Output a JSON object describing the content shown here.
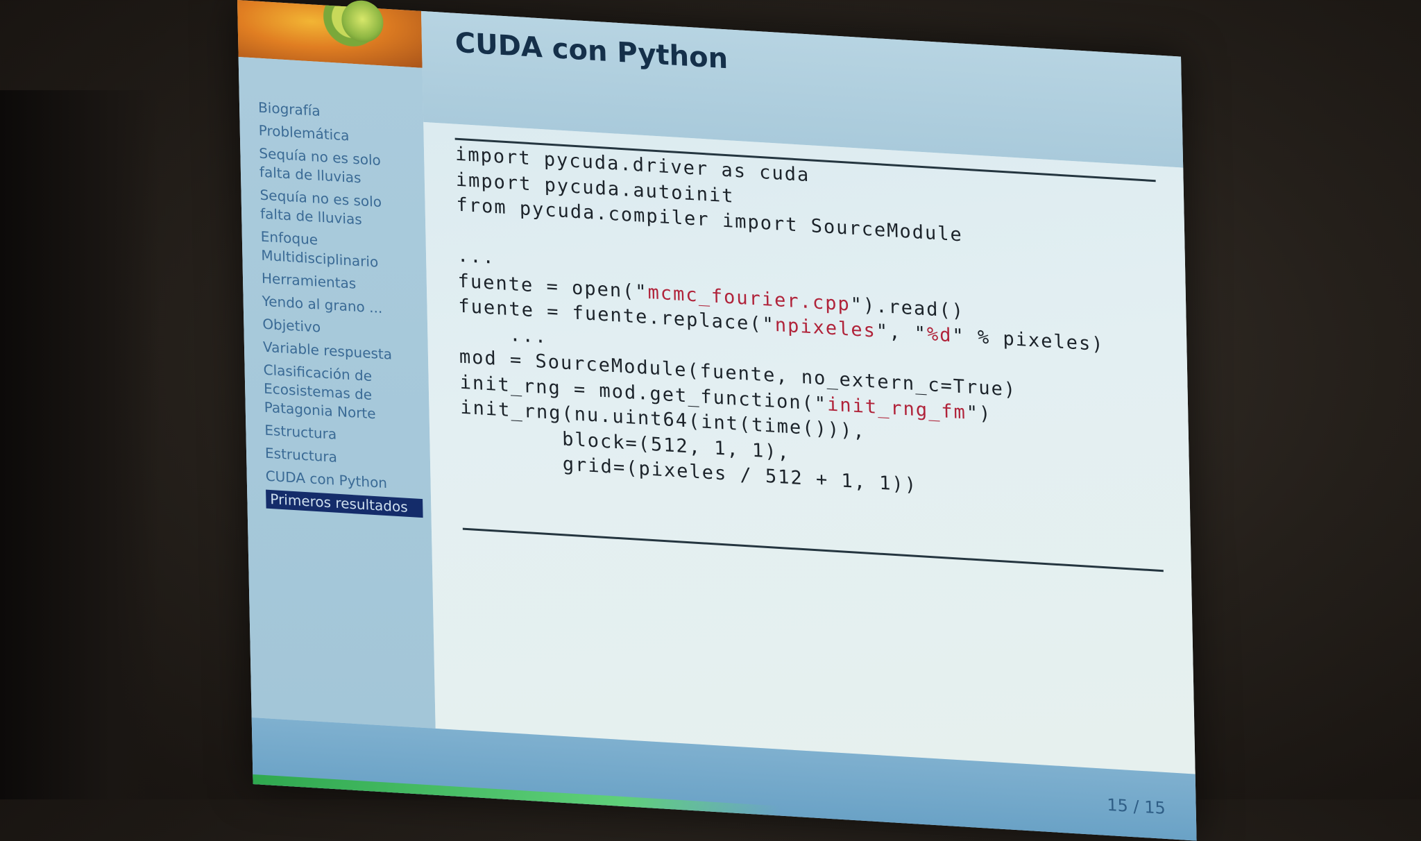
{
  "slide": {
    "title": "CUDA con Python",
    "page_number": "15 / 15"
  },
  "sidebar": {
    "items": [
      {
        "label": "Biografía"
      },
      {
        "label": "Problemática"
      },
      {
        "label": "Sequía no es solo falta de lluvias"
      },
      {
        "label": "Sequía no es solo falta de lluvias"
      },
      {
        "label": "Enfoque Multidisciplinario"
      },
      {
        "label": "Herramientas"
      },
      {
        "label": "Yendo al grano ..."
      },
      {
        "label": "Objetivo"
      },
      {
        "label": "Variable respuesta"
      },
      {
        "label": "Clasificación de Ecosistemas de Patagonia Norte"
      },
      {
        "label": "Estructura"
      },
      {
        "label": "Estructura"
      },
      {
        "label": "CUDA con Python"
      },
      {
        "label": "Primeros resultados"
      }
    ],
    "active_index": 13
  },
  "code": {
    "lines": [
      [
        "import pycuda.driver as cuda"
      ],
      [
        "import pycuda.autoinit"
      ],
      [
        "from pycuda.compiler import SourceModule"
      ],
      [
        ""
      ],
      [
        "..."
      ],
      [
        "fuente = open(\"",
        "mcmc_fourier.cpp",
        "\").read()"
      ],
      [
        "fuente = fuente.replace(\"",
        "npixeles",
        "\", \"",
        "%d",
        "\" % pixeles)"
      ],
      [
        "    ..."
      ],
      [
        "mod = SourceModule(fuente, no_extern_c=True)"
      ],
      [
        "init_rng = mod.get_function(\"",
        "init_rng_fm",
        "\")"
      ],
      [
        "init_rng(nu.uint64(int(time())),"
      ],
      [
        "        block=(512, 1, 1),"
      ],
      [
        "        grid=(pixeles / 512 + 1, 1))"
      ]
    ]
  },
  "colors": {
    "title_text": "#15304a",
    "sidebar_text": "#3a6a95",
    "active_bg": "#142c6a",
    "string_literal": "#b0233a",
    "footer_bar": "#6aa2c6"
  }
}
